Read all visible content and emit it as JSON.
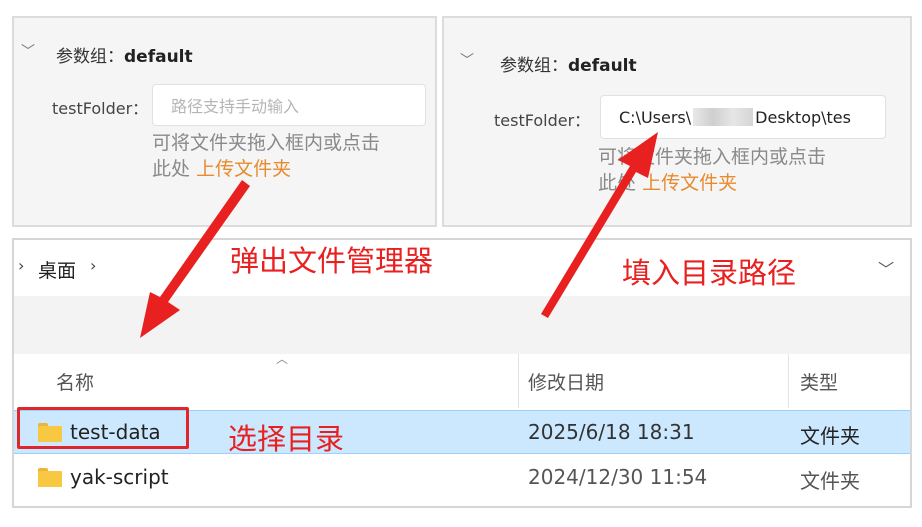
{
  "left_panel": {
    "group_label": "参数组：",
    "group_name": "default",
    "field_label": "testFolder：",
    "input_placeholder": "路径支持手动输入",
    "hint_line1": "可将文件夹拖入框内或点击",
    "hint_line2": "此处",
    "upload_link": "上传文件夹"
  },
  "right_panel": {
    "group_label": "参数组：",
    "group_name": "default",
    "field_label": "testFolder：",
    "input_value_prefix": "C:\\Users\\",
    "input_value_suffix": "Desktop\\tes",
    "hint_line1": "可将文件夹拖入框内或点击",
    "hint_line2": "此处",
    "upload_link": "上传文件夹"
  },
  "explorer": {
    "breadcrumb": "桌面",
    "columns": [
      "名称",
      "修改日期",
      "类型"
    ],
    "rows": [
      {
        "name": "test-data",
        "date": "2025/6/18 18:31",
        "type": "文件夹",
        "selected": true
      },
      {
        "name": "yak-script",
        "date": "2024/12/30 11:54",
        "type": "文件夹",
        "selected": false
      }
    ]
  },
  "annotations": {
    "popup_explorer": "弹出文件管理器",
    "fill_path": "填入目录路径",
    "select_dir": "选择目录"
  },
  "colors": {
    "annotation_red": "#e8201f",
    "link_orange": "#e88a2e",
    "selection_blue": "#cce8ff",
    "folder_yellow": "#f8c843"
  },
  "icons": [
    "chevron-down-icon",
    "chevron-right-icon",
    "folder-icon",
    "sort-up-icon"
  ]
}
